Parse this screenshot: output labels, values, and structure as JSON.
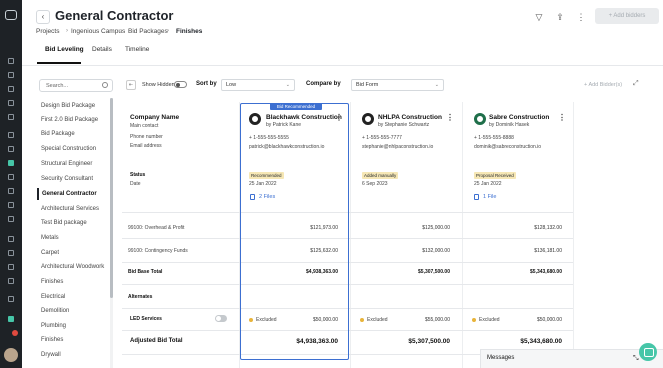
{
  "header": {
    "title": "General Contractor",
    "breadcrumbs": [
      "Projects",
      "Ingenious Campus",
      "Bid Packages",
      "Finishes"
    ],
    "add_bidders": "Add bidders",
    "tabs": [
      "Bid Leveling",
      "Details",
      "Timeline"
    ],
    "active_tab": "Bid Leveling"
  },
  "sidebar": {
    "search_placeholder": "Search...",
    "items": [
      "Design Bid Package",
      "First 2.0 Bid Package",
      "Bid Package",
      "Special Construction",
      "Structural Engineer",
      "Security Consultant",
      "General Contractor",
      "Architectural Services",
      "Test Bid package",
      "Metals",
      "Carpet",
      "Architectural Woodwork",
      "Finishes",
      "Electrical",
      "Demolition",
      "Plumbing",
      "Finishes",
      "Drywall"
    ],
    "selected": "General Contractor"
  },
  "toolbar": {
    "show_hidden": "Show Hidden",
    "sort_by": "Sort by",
    "sort_value": "Low",
    "compare_by": "Compare by",
    "compare_value": "Bid Form",
    "add_bidder": "Add Bidder(s)"
  },
  "labels": {
    "company_name": "Company Name",
    "main_contact": "Main contact",
    "phone": "Phone number",
    "email": "Email address",
    "status": "Status",
    "date": "Date",
    "overhead": "99100: Overhead & Profit",
    "contingency": "99100: Contingency Funds",
    "base_total": "Bid Base Total",
    "alternates": "Alternates",
    "led": "LED Services",
    "adjusted": "Adjusted Bid Total"
  },
  "bidders": [
    {
      "name": "Blackhawk Construction",
      "contact": "by Patrick Kane",
      "phone": "+ 1-555-555-5555",
      "email": "patrick@blackhawkconstruction.io",
      "status": "Recommended",
      "date": "25 Jan 2022",
      "files": "2 Files",
      "overhead": "$121,973.00",
      "contingency": "$125,632.00",
      "base_total": "$4,938,363.00",
      "led_status": "Excluded",
      "led_value": "$50,000.00",
      "adjusted": "$4,938,363.00",
      "flag": "Bid Recommended",
      "status_color": "#f6e7b5"
    },
    {
      "name": "NHLPA Construction",
      "contact": "by Stephanie Schwartz",
      "phone": "+ 1-555-555-7777",
      "email": "stephanie@nhlpaconstruction.io",
      "status": "Added manually",
      "date": "6 Sep 2023",
      "files": "",
      "overhead": "$125,000.00",
      "contingency": "$132,000.00",
      "base_total": "$5,307,500.00",
      "led_status": "Excluded",
      "led_value": "$55,000.00",
      "adjusted": "$5,307,500.00",
      "flag": "",
      "status_color": "#f6e7b5"
    },
    {
      "name": "Sabre Construction",
      "contact": "by Dominik Hasek",
      "phone": "+ 1-555-555-8888",
      "email": "dominik@sabreconstruction.io",
      "status": "Proposal Received",
      "date": "25 Jan 2022",
      "files": "1 File",
      "overhead": "$128,132.00",
      "contingency": "$136,181.00",
      "base_total": "$5,343,680.00",
      "led_status": "Excluded",
      "led_value": "$50,000.00",
      "adjusted": "$5,343,680.00",
      "flag": "",
      "status_color": "#f6e7b5"
    }
  ],
  "messages": "Messages",
  "colors": {
    "accent": "#3c6fd1",
    "brand": "#46c6a8",
    "rail": "#1e2226"
  }
}
